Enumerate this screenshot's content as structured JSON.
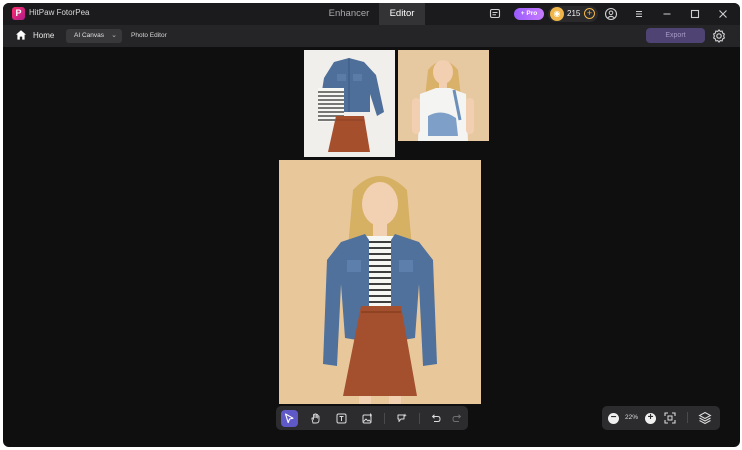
{
  "app": {
    "name": "HitPaw FotorPea",
    "logo_letter": "P"
  },
  "mode_tabs": [
    {
      "label": "Enhancer",
      "active": false
    },
    {
      "label": "Editor",
      "active": true
    }
  ],
  "titlebar": {
    "pro_badge": "+ Pro",
    "coins": "215",
    "coin_glyph": "◉",
    "coin_plus": "+",
    "icons": [
      "feedback-icon",
      "account-icon",
      "menu-icon",
      "minimize-icon",
      "maximize-icon",
      "close-icon"
    ]
  },
  "toolbar": {
    "home_label": "Home",
    "canvas_select": "AI Canvas",
    "chevron": "⌄",
    "photo_editor_label": "Photo Editor",
    "export_label": "Export"
  },
  "canvas_images": [
    {
      "name": "clothes-flatlay-image",
      "description_visible": false
    },
    {
      "name": "model-reference-image"
    },
    {
      "name": "generated-outfit-image"
    }
  ],
  "bottom_dock": {
    "tools": [
      "select-tool",
      "hand-tool",
      "text-tool",
      "add-image-tool",
      "ai-generate-tool",
      "undo",
      "redo"
    ],
    "active_tool": "select-tool"
  },
  "zoom": {
    "level": "22%",
    "minus": "−",
    "plus": "+"
  },
  "colors": {
    "accent": "#5f59c7",
    "export_bg": "#4e4372",
    "pro_badge": "#b06cff",
    "coin": "#f0b64a",
    "canvas_bg": "#0f0f10"
  }
}
